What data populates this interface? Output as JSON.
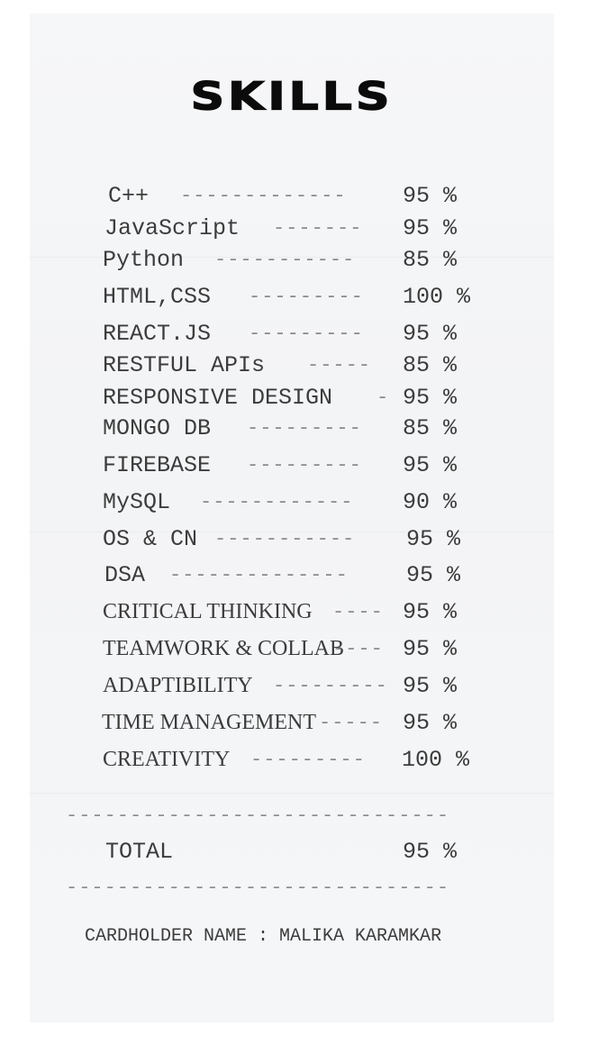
{
  "receipt": {
    "title": "SKILLS",
    "skills": [
      {
        "name": "C++",
        "dashes": "-------------",
        "percent": "95 %"
      },
      {
        "name": "JavaScript",
        "dashes": "-------",
        "percent": "95 %"
      },
      {
        "name": "Python",
        "dashes": "-----------",
        "percent": "85 %"
      },
      {
        "name": "HTML,CSS",
        "dashes": "---------",
        "percent": "100 %"
      },
      {
        "name": "REACT.JS",
        "dashes": "---------",
        "percent": "95 %"
      },
      {
        "name": "RESTFUL APIs",
        "dashes": "-----",
        "percent": "85 %"
      },
      {
        "name": "RESPONSIVE DESIGN",
        "dashes": "-",
        "percent": "95 %"
      },
      {
        "name": "MONGO DB",
        "dashes": "---------",
        "percent": "85 %"
      },
      {
        "name": "FIREBASE",
        "dashes": "---------",
        "percent": "95 %"
      },
      {
        "name": "MySQL",
        "dashes": "------------",
        "percent": "90 %"
      },
      {
        "name": "OS & CN",
        "dashes": "-----------",
        "percent": "95 %"
      },
      {
        "name": "DSA",
        "dashes": "--------------",
        "percent": "95 %"
      },
      {
        "name": "CRITICAL THINKING",
        "dashes": "----",
        "percent": "95 %"
      },
      {
        "name": "TEAMWORK & COLLAB",
        "dashes": "----",
        "percent": "95 %"
      },
      {
        "name": "ADAPTIBILITY",
        "dashes": "---------",
        "percent": "95 %"
      },
      {
        "name": "TIME MANAGEMENT",
        "dashes": "-----",
        "percent": "95 %"
      },
      {
        "name": "CREATIVITY",
        "dashes": "---------",
        "percent": "100 %"
      }
    ],
    "divider": "------------------------------",
    "total_label": "TOTAL",
    "total_value": "95 %",
    "cardholder": "CARDHOLDER NAME : MALIKA KARAMKAR"
  }
}
